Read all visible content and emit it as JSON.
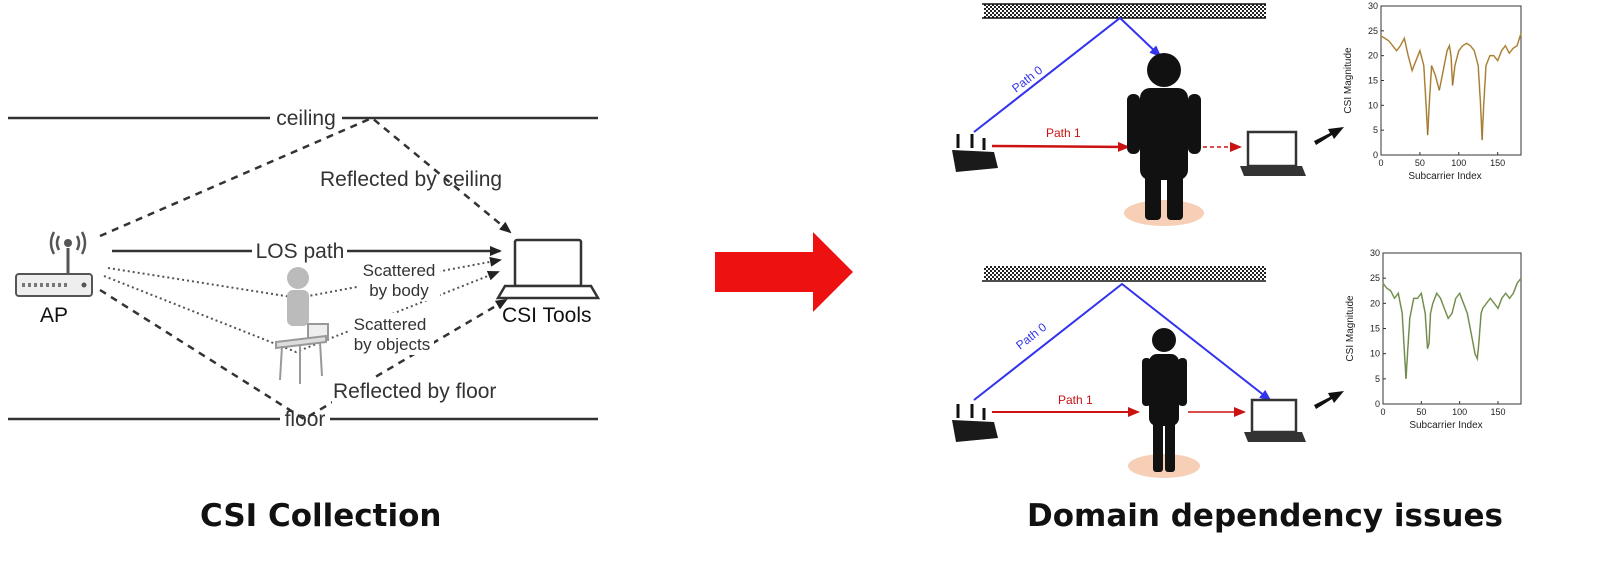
{
  "left_diagram": {
    "ceiling_label": "ceiling",
    "floor_label": "floor",
    "ap_label": "AP",
    "csi_tools_label": "CSI Tools",
    "reflected_ceiling_label": "Reflected by ceiling",
    "los_label": "LOS path",
    "scattered_body_line1": "Scattered",
    "scattered_body_line2": "by body",
    "scattered_objects_line1": "Scattered",
    "scattered_objects_line2": "by objects",
    "reflected_floor_label": "Reflected by floor",
    "caption": "CSI Collection"
  },
  "right_diagram": {
    "path0_label": "Path 0",
    "path1_label": "Path 1",
    "caption": "Domain dependency issues"
  },
  "colors": {
    "arrow_red": "#ee1111",
    "path0_blue": "#3333ee",
    "path1_red": "#cc1111",
    "curve_top": "#c99a45",
    "curve_bottom": "#8aa860",
    "shadow": "#f6cfb6"
  },
  "chart_data": [
    {
      "type": "line",
      "title": "",
      "xlabel": "Subcarrier Index",
      "ylabel": "CSI Magnitude",
      "xticks": [
        "0",
        "50",
        "100",
        "150"
      ],
      "yticks": [
        "0",
        "5",
        "10",
        "15",
        "20",
        "25",
        "30"
      ],
      "xlim": [
        0,
        180
      ],
      "ylim": [
        0,
        30
      ],
      "series": [
        {
          "x": [
            0,
            5,
            10,
            15,
            20,
            25,
            30,
            35,
            40,
            45,
            50,
            55,
            58,
            60,
            62,
            65,
            70,
            75,
            80,
            85,
            88,
            90,
            92,
            95,
            100,
            105,
            110,
            115,
            120,
            125,
            128,
            130,
            132,
            135,
            140,
            145,
            150,
            155,
            160,
            165,
            170,
            175,
            180
          ],
          "y": [
            24,
            23.5,
            23,
            22,
            21,
            22,
            23.5,
            20,
            17,
            19,
            21,
            18,
            10,
            4,
            10,
            18,
            16,
            13,
            17,
            21,
            22,
            20,
            14,
            18,
            21,
            22,
            22.5,
            22,
            21,
            18,
            10,
            3,
            10,
            18,
            20,
            20,
            19,
            21,
            22,
            20.5,
            21.5,
            22,
            24.5
          ]
        }
      ]
    },
    {
      "type": "line",
      "title": "",
      "xlabel": "Subcarrier Index",
      "ylabel": "CSI Magnitude",
      "xticks": [
        "0",
        "50",
        "100",
        "150"
      ],
      "yticks": [
        "0",
        "5",
        "10",
        "15",
        "20",
        "25",
        "30"
      ],
      "xlim": [
        0,
        180
      ],
      "ylim": [
        0,
        30
      ],
      "series": [
        {
          "x": [
            0,
            5,
            10,
            15,
            20,
            25,
            28,
            30,
            32,
            35,
            40,
            45,
            50,
            55,
            58,
            60,
            62,
            65,
            70,
            75,
            80,
            85,
            90,
            95,
            100,
            105,
            110,
            115,
            120,
            123,
            125,
            128,
            130,
            135,
            140,
            145,
            150,
            155,
            160,
            165,
            170,
            175,
            180
          ],
          "y": [
            24,
            23,
            22.5,
            21,
            22,
            18,
            10,
            5,
            10,
            17,
            21,
            21,
            22,
            18,
            11,
            12,
            18,
            20,
            22,
            21,
            19,
            17,
            18,
            21,
            22,
            20,
            18,
            14,
            10,
            9,
            12,
            18,
            19,
            20,
            21,
            20,
            19,
            21,
            22,
            21,
            22,
            24,
            25
          ]
        }
      ]
    }
  ]
}
